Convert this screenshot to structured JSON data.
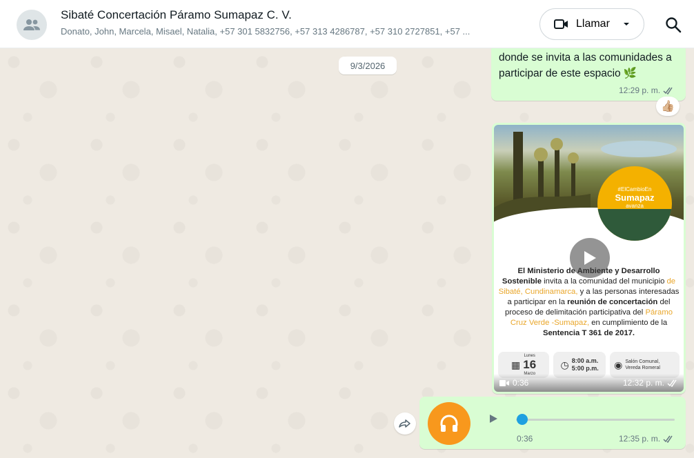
{
  "header": {
    "title": "Sibaté Concertación Páramo Sumapaz C. V.",
    "members": "Donato, John, Marcela, Misael, Natalia, +57 301 5832756, +57 313 4286787, +57 310 2727851, +57 ...",
    "call_label": "Llamar",
    "icons": {
      "avatar": "group-icon",
      "call": "video-camera-icon",
      "dropdown": "chevron-down-icon",
      "search": "search-icon"
    }
  },
  "date_separator": "9/3/2026",
  "messages": [
    {
      "type": "text",
      "text": "donde se invita a las comunidades a participar de este espacio 🌿",
      "time": "12:29 p. m.",
      "reaction": "👍🏼"
    },
    {
      "type": "video",
      "duration": "0:36",
      "time": "12:32 p. m.",
      "poster": {
        "logo_line1": "#ElCambioEn",
        "logo_line2": "Sumapaz",
        "logo_line3": "avanza",
        "p1_bold": "El Ministerio de Ambiente y Desarrollo Sostenible",
        "p1_rest": " invita a la comunidad del municipio ",
        "place": "de Sibaté, Cundinamarca,",
        "p2": " y a las personas interesadas a participar en la ",
        "p2_bold": "reunión de concertación",
        "p3": " del proceso de delimitación participativa del ",
        "paramo": "Páramo Cruz Verde -Sumapaz,",
        "p4": " en cumplimiento de la ",
        "p4_bold": "Sentencia T 361 de 2017.",
        "day_name": "Lunes",
        "day_num": "16",
        "month": "Marzo",
        "time_start": "8:00 a.m.",
        "time_end": "5:00 p.m.",
        "venue": "Salón Comunal, Vereda Romeral"
      }
    },
    {
      "type": "audio",
      "duration": "0:36",
      "time": "12:35 p. m.",
      "icons": {
        "avatar": "headphones-icon",
        "play": "play-icon",
        "forward": "forward-icon"
      }
    }
  ],
  "colors": {
    "bubble_out": "#d9fdd3",
    "accent_audio": "#f8981d",
    "read_tick": "#667781",
    "knob": "#1fa0e0"
  }
}
